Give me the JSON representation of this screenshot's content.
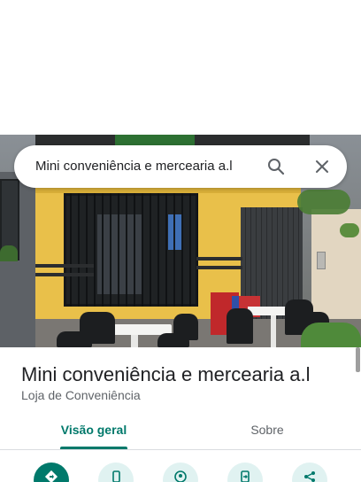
{
  "search": {
    "query": "Mini conveniência e mercearia a.l",
    "search_icon": "search-icon",
    "close_icon": "close-icon"
  },
  "place": {
    "title": "Mini conveniência e mercearia a.l",
    "category": "Loja de Conveniência"
  },
  "tabs": [
    {
      "label": "Visão geral",
      "selected": true
    },
    {
      "label": "Sobre",
      "selected": false
    }
  ],
  "actions": [
    {
      "icon": "directions-icon",
      "primary": true
    },
    {
      "icon": "phone-icon",
      "primary": false
    },
    {
      "icon": "location-save-icon",
      "primary": false
    },
    {
      "icon": "send-to-phone-icon",
      "primary": false
    },
    {
      "icon": "share-icon",
      "primary": false
    }
  ],
  "colors": {
    "accent": "#00796b",
    "action_bg": "#e0f2f1",
    "title_text": "#202124",
    "secondary_text": "#5f6368"
  }
}
